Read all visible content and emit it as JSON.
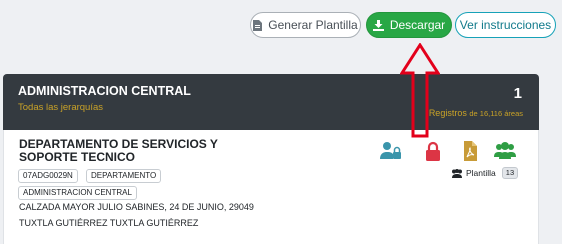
{
  "toolbar": {
    "generar_label": "Generar Plantilla",
    "descargar_label": "Descargar",
    "ver_label": "Ver instrucciones"
  },
  "header": {
    "title": "ADMINISTRACION CENTRAL",
    "subtitle": "Todas las jerarquías",
    "count": "1",
    "registros_label": "Registros",
    "registros_detail": "de 16,116 áreas"
  },
  "card": {
    "name": "DEPARTAMENTO DE SERVICIOS Y SOPORTE TECNICO",
    "code": "07ADG0029N",
    "type": "DEPARTAMENTO",
    "parent": "ADMINISTRACION CENTRAL",
    "address": "CALZADA MAYOR JULIO SABINES, 24 DE JUNIO, 29049",
    "city": "TUXTLA GUTIÉRREZ TUXTLA GUTIÉRREZ",
    "plantilla_label": "Plantilla",
    "plantilla_count": "13"
  },
  "icons": [
    "file-text-icon",
    "download-icon",
    "user-lock-icon",
    "lock-icon",
    "pdf-file-icon",
    "users-icon",
    "group-icon"
  ],
  "colors": {
    "success": "#28a745",
    "info": "#17a2b8",
    "header_bg": "#343a40",
    "gold": "#c9a227",
    "danger": "#dc3545",
    "teal": "#3a95ab",
    "pdf": "#c89b38",
    "green_icon": "#2f9e44",
    "annotation_arrow": "#e3001b"
  }
}
